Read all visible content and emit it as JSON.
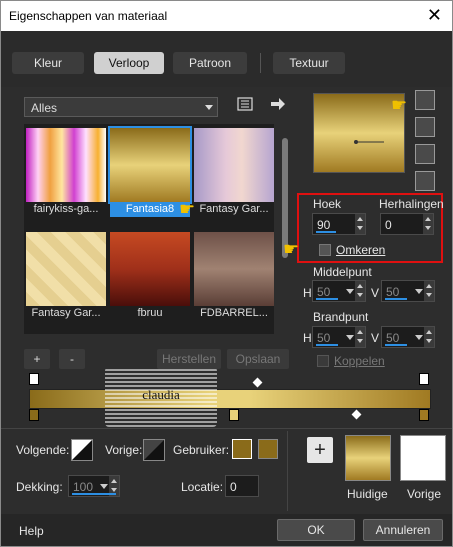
{
  "window": {
    "title": "Eigenschappen van materiaal",
    "close_glyph": "✕"
  },
  "tabs": [
    {
      "label": "Kleur",
      "active": false
    },
    {
      "label": "Verloop",
      "active": true
    },
    {
      "label": "Patroon",
      "active": false
    },
    {
      "label": "Textuur",
      "active": false
    }
  ],
  "gallery": {
    "category": "Alles",
    "items": [
      {
        "label": "fairykiss-ga..."
      },
      {
        "label": "Fantasia8",
        "selected": true
      },
      {
        "label": "Fantasy Gar..."
      },
      {
        "label": "Fantasy Gar..."
      },
      {
        "label": "fbruu"
      },
      {
        "label": "FDBARREL..."
      }
    ],
    "add_label": "+",
    "remove_label": "-",
    "restore_label": "Herstellen",
    "save_label": "Opslaan"
  },
  "angle": {
    "label": "Hoek",
    "value": "90"
  },
  "repeats": {
    "label": "Herhalingen",
    "value": "0"
  },
  "invert": {
    "label": "Omkeren",
    "checked": false
  },
  "center": {
    "label": "Middelpunt",
    "h_label": "H",
    "h_value": "50",
    "v_label": "V",
    "v_value": "50"
  },
  "focus": {
    "label": "Brandpunt",
    "h_label": "H",
    "h_value": "50",
    "v_label": "V",
    "v_value": "50"
  },
  "link_label": "Koppelen",
  "watermark": "claudia",
  "stops": {
    "next_label": "Volgende:",
    "prev_label": "Vorige:",
    "user_label": "Gebruiker:",
    "opacity_label": "Dekking:",
    "opacity_value": "100",
    "location_label": "Locatie:",
    "location_value": "0"
  },
  "preview": {
    "current_label": "Huidige",
    "previous_label": "Vorige",
    "add_glyph": "+"
  },
  "footer": {
    "help_label": "Help",
    "ok_label": "OK",
    "cancel_label": "Annuleren"
  },
  "colors": {
    "gold_dark": "#8a6b1a",
    "gold_light": "#e8d27a",
    "highlight_red": "#e01010",
    "accent_blue": "#2d8fe3"
  }
}
